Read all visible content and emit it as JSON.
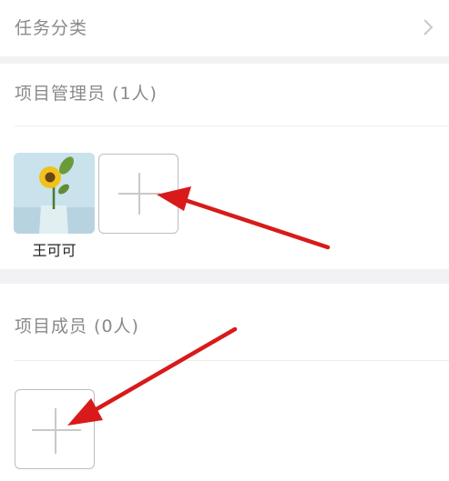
{
  "task_category": {
    "label": "任务分类"
  },
  "managers": {
    "title": "项目管理员 (1人)",
    "members": [
      {
        "name": "王可可"
      }
    ]
  },
  "members": {
    "title": "项目成员 (0人)"
  },
  "colors": {
    "divider_band": "#f2f2f4",
    "arrow": "#d81a1a",
    "label": "#8a8a8a"
  },
  "icons": {
    "chevron": "chevron-right-icon",
    "add": "plus-icon"
  }
}
